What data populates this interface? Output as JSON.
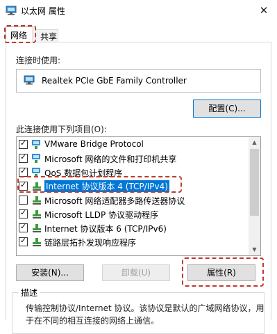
{
  "window": {
    "title": "以太网 属性",
    "close_glyph": "✕"
  },
  "tabs": [
    {
      "label": "网络"
    },
    {
      "label": "共享"
    }
  ],
  "connect_using": {
    "label": "连接时使用:",
    "adapter": "Realtek PCIe GbE Family Controller"
  },
  "configure_button": "配置(C)...",
  "items_label": "此连接使用下列项目(O):",
  "items": [
    {
      "label": "VMware Bridge Protocol",
      "checked": true,
      "icon": "network-protocol-icon"
    },
    {
      "label": "Microsoft 网络的文件和打印机共享",
      "checked": true,
      "icon": "network-service-icon"
    },
    {
      "label": "QoS 数据包计划程序",
      "checked": true,
      "icon": "network-service-icon"
    },
    {
      "label": "Internet 协议版本 4 (TCP/IPv4)",
      "checked": true,
      "icon": "protocol-icon",
      "selected": true
    },
    {
      "label": "Microsoft 网络适配器多路传送器协议",
      "checked": false,
      "icon": "protocol-icon"
    },
    {
      "label": "Microsoft LLDP 协议驱动程序",
      "checked": true,
      "icon": "protocol-icon"
    },
    {
      "label": "Internet 协议版本 6 (TCP/IPv6)",
      "checked": true,
      "icon": "protocol-icon"
    },
    {
      "label": "链路层拓扑发现响应程序",
      "checked": true,
      "icon": "protocol-icon"
    }
  ],
  "buttons": {
    "install": "安装(N)...",
    "uninstall": "卸载(U)",
    "properties": "属性(R)"
  },
  "description": {
    "title": "描述",
    "line1": "传输控制协议/Internet 协议。该协议是默认的广域网络协议，用",
    "line2": "于在不同的相互连接的网络上通信。"
  },
  "colors": {
    "selection": "#0078d7",
    "highlight_dash": "#c0392b",
    "focus_border": "#0078d7"
  }
}
